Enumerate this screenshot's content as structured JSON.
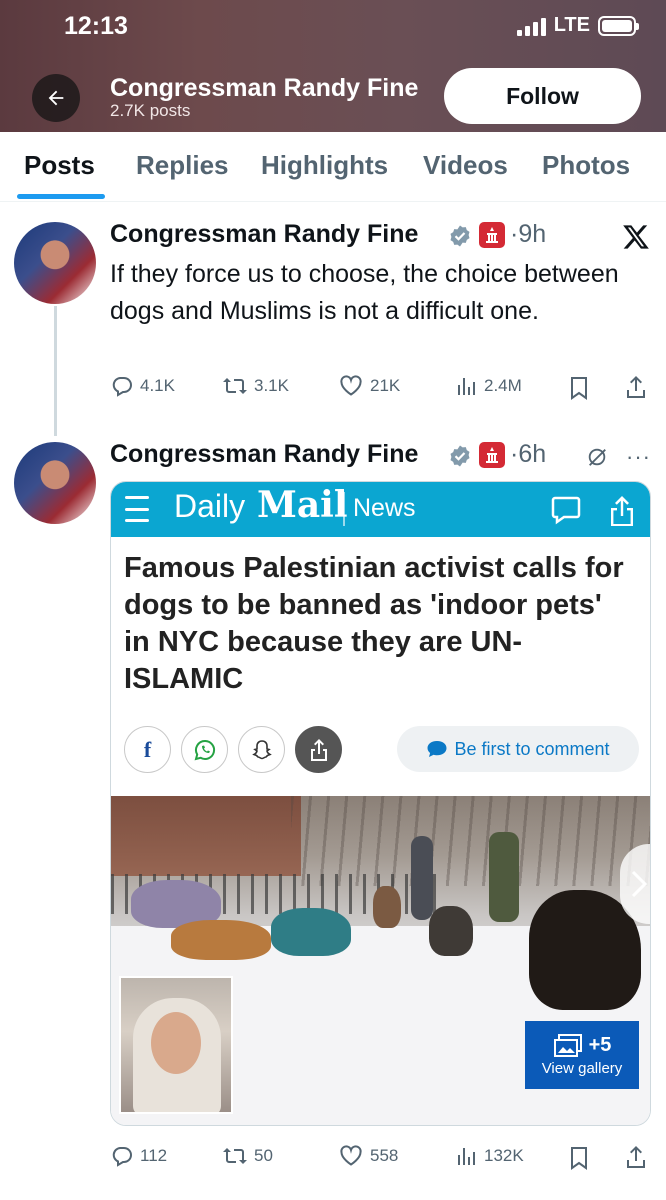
{
  "status_bar": {
    "time": "12:13",
    "network": "LTE"
  },
  "header": {
    "profile_name": "Congressman Randy Fine",
    "post_count": "2.7K posts",
    "follow_label": "Follow"
  },
  "tabs": [
    {
      "label": "Posts",
      "active": true
    },
    {
      "label": "Replies"
    },
    {
      "label": "Highlights"
    },
    {
      "label": "Videos"
    },
    {
      "label": "Photos"
    }
  ],
  "tweets": [
    {
      "author": "Congressman Randy Fine",
      "time": "9h",
      "text": "If they force us to choose, the choice between dogs and Muslims is not a difficult one.",
      "replies": "4.1K",
      "reposts": "3.1K",
      "likes": "21K",
      "views": "2.4M"
    },
    {
      "author": "Congressman Randy Fine",
      "time": "6h",
      "card": {
        "brand_daily": "Daily",
        "brand_mail": "Mail",
        "brand_section": "News",
        "headline": "Famous Palestinian activist calls for dogs to be banned as 'indoor pets' in NYC because they are UN-ISLAMIC",
        "comment_prompt": "Be first to comment",
        "gallery_count": "+5",
        "gallery_label": "View gallery"
      },
      "replies": "112",
      "reposts": "50",
      "likes": "558",
      "views": "132K"
    }
  ],
  "colors": {
    "accent": "#1d9bf0",
    "dailymail_blue": "#0ba6d1",
    "gallery_blue": "#0b5ab8"
  }
}
